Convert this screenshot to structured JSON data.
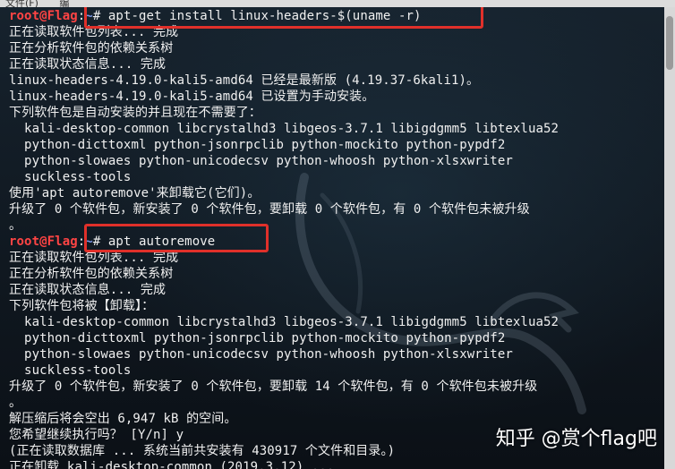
{
  "menubar": {
    "items": [
      "文件(F)",
      "编"
    ]
  },
  "terminal": {
    "prompt_user": "root@Flag",
    "prompt_sep": ":",
    "prompt_path": "~",
    "prompt_symbol": "# ",
    "command_1": "apt-get install linux-headers-$(uname -r)",
    "output_1": [
      "正在读取软件包列表... 完成",
      "正在分析软件包的依赖关系树",
      "正在读取状态信息... 完成",
      "linux-headers-4.19.0-kali5-amd64 已经是最新版 (4.19.37-6kali1)。",
      "linux-headers-4.19.0-kali5-amd64 已设置为手动安装。",
      "下列软件包是自动安装的并且现在不需要了：",
      "  kali-desktop-common libcrystalhd3 libgeos-3.7.1 libigdgmm5 libtexlua52",
      "  python-dicttoxml python-jsonrpclib python-mockito python-pypdf2",
      "  python-slowaes python-unicodecsv python-whoosh python-xlsxwriter",
      "  suckless-tools",
      "使用'apt autoremove'来卸载它(它们)。",
      "升级了 0 个软件包，新安装了 0 个软件包，要卸载 0 个软件包，有 0 个软件包未被升级",
      "。"
    ],
    "command_2": "apt autoremove",
    "output_2": [
      "正在读取软件包列表... 完成",
      "正在分析软件包的依赖关系树",
      "正在读取状态信息... 完成",
      "下列软件包将被【卸载】：",
      "  kali-desktop-common libcrystalhd3 libgeos-3.7.1 libigdgmm5 libtexlua52",
      "  python-dicttoxml python-jsonrpclib python-mockito python-pypdf2",
      "  python-slowaes python-unicodecsv python-whoosh python-xlsxwriter",
      "  suckless-tools",
      "升级了 0 个软件包，新安装了 0 个软件包，要卸载 14 个软件包，有 0 个软件包未被升级",
      "。",
      "解压缩后将会空出 6,947 kB 的空间。",
      "您希望继续执行吗？ [Y/n] y",
      "(正在读取数据库 ... 系统当前共安装有 430917 个文件和目录。)",
      "正在卸载 kali-desktop-common (2019.3.12) ..."
    ]
  },
  "watermark": "知乎 @赏个flag吧",
  "colors": {
    "highlight_box": "#e0302a",
    "prompt_user": "#ff4444",
    "prompt_path": "#7b96e8"
  }
}
